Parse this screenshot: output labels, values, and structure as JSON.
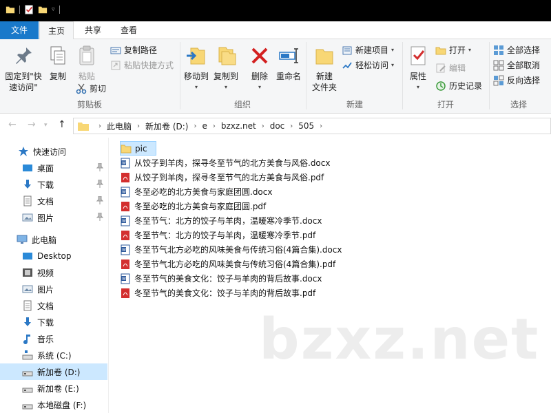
{
  "ribbon_tabs": {
    "file": "文件",
    "home": "主页",
    "share": "共享",
    "view": "查看"
  },
  "clipboard": {
    "pin_label_1": "固定到\"快",
    "pin_label_2": "速访问\"",
    "copy": "复制",
    "paste": "粘贴",
    "copy_path": "复制路径",
    "paste_shortcut": "粘贴快捷方式",
    "cut": "剪切",
    "group": "剪贴板"
  },
  "organize": {
    "move_to": "移动到",
    "copy_to": "复制到",
    "delete": "删除",
    "rename": "重命名",
    "group": "组织"
  },
  "new": {
    "new_folder_1": "新建",
    "new_folder_2": "文件夹",
    "new_item": "新建项目",
    "easy_access": "轻松访问",
    "group": "新建"
  },
  "open": {
    "properties": "属性",
    "open": "打开",
    "edit": "编辑",
    "history": "历史记录",
    "group": "打开"
  },
  "select": {
    "select_all": "全部选择",
    "select_none": "全部取消",
    "invert": "反向选择",
    "group": "选择"
  },
  "breadcrumb": [
    "此电脑",
    "新加卷 (D:)",
    "e",
    "bzxz.net",
    "doc",
    "505"
  ],
  "sidebar": {
    "quick_access": "快速访问",
    "quick_items": [
      "桌面",
      "下载",
      "文档",
      "图片"
    ],
    "this_pc": "此电脑",
    "pc_items": [
      "Desktop",
      "视频",
      "图片",
      "文档",
      "下载",
      "音乐",
      "系统 (C:)",
      "新加卷 (D:)",
      "新加卷 (E:)",
      "本地磁盘 (F:)"
    ]
  },
  "files": [
    {
      "name": "pic",
      "type": "folder"
    },
    {
      "name": "从饺子到羊肉，探寻冬至节气的北方美食与风俗.docx",
      "type": "docx"
    },
    {
      "name": "从饺子到羊肉，探寻冬至节气的北方美食与风俗.pdf",
      "type": "pdf"
    },
    {
      "name": "冬至必吃的北方美食与家庭团圆.docx",
      "type": "docx"
    },
    {
      "name": "冬至必吃的北方美食与家庭团圆.pdf",
      "type": "pdf"
    },
    {
      "name": "冬至节气：北方的饺子与羊肉，温暖寒冷季节.docx",
      "type": "docx"
    },
    {
      "name": "冬至节气：北方的饺子与羊肉，温暖寒冷季节.pdf",
      "type": "pdf"
    },
    {
      "name": "冬至节气北方必吃的风味美食与传统习俗(4篇合集).docx",
      "type": "docx"
    },
    {
      "name": "冬至节气北方必吃的风味美食与传统习俗(4篇合集).pdf",
      "type": "pdf"
    },
    {
      "name": "冬至节气的美食文化：饺子与羊肉的背后故事.docx",
      "type": "docx"
    },
    {
      "name": "冬至节气的美食文化：饺子与羊肉的背后故事.pdf",
      "type": "pdf"
    }
  ],
  "watermark": "bzxz.net",
  "colors": {
    "accent": "#1979ca",
    "selection": "#cce8ff",
    "folder": "#f8d775",
    "pdf": "#d32f2f",
    "word": "#2b579a"
  }
}
